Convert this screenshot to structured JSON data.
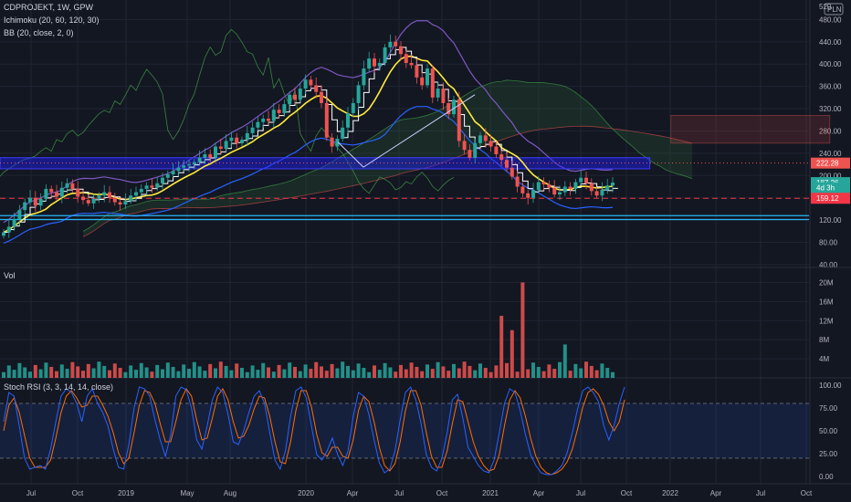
{
  "legend": {
    "symbol": "CDPROJEKT, 1W, GPW",
    "ichimoku": "Ichimoku (20, 60, 120, 30)",
    "bb": "BB (20, close, 2, 0)",
    "vol": "Vol",
    "stoch": "Stoch RSI (3, 3, 14, 14, close)"
  },
  "currency": "PLN",
  "top_label": "520",
  "colors": {
    "bg": "#131722",
    "grid": "#1f2433",
    "up": "#26a69a",
    "down": "#ef5350",
    "tenkan": "#ffffff",
    "kijun": "#ffeb3b",
    "bb": "#2962ff",
    "bb_upper": "#7e57c2",
    "lagging": "#43a047",
    "stoch_k": "#2962ff",
    "stoch_d": "#ff6d00",
    "blue_band": "#1f1fff"
  },
  "chart_data": {
    "type": "candlestick",
    "price_panel": {
      "y_ticks": [
        "480.00",
        "440.00",
        "400.00",
        "360.00",
        "320.00",
        "280.00",
        "240.00",
        "200.00",
        "160.00",
        "120.00",
        "80.00",
        "40.00"
      ],
      "ylim": [
        35,
        515
      ],
      "price_badges": [
        {
          "label": "222.28",
          "value": 222.28,
          "color": "#ef5350"
        },
        {
          "label": "187.26",
          "value": 187.26,
          "color": "#26a69a"
        },
        {
          "label": "4d 3h",
          "value": 178,
          "color": "#26a69a"
        },
        {
          "label": "159.12",
          "value": 159.12,
          "color": "#f23645"
        }
      ],
      "horizontal_levels": [
        {
          "value": 222.28,
          "style": "dotted",
          "color": "#ef5350"
        },
        {
          "value": 159.12,
          "style": "dashed",
          "color": "#f23645"
        },
        {
          "value": 128,
          "style": "solid",
          "color": "#29b6f6"
        },
        {
          "value": 121,
          "style": "solid",
          "color": "#29b6f6"
        }
      ],
      "blue_band_range": [
        212,
        232
      ],
      "close_series": [
        98,
        108,
        122,
        138,
        152,
        160,
        146,
        158,
        176,
        170,
        162,
        178,
        186,
        176,
        162,
        156,
        150,
        158,
        164,
        170,
        160,
        152,
        148,
        154,
        164,
        170,
        176,
        182,
        178,
        186,
        196,
        202,
        208,
        214,
        218,
        220,
        224,
        232,
        238,
        232,
        252,
        248,
        262,
        268,
        258,
        264,
        276,
        286,
        296,
        302,
        298,
        318,
        312,
        328,
        345,
        336,
        356,
        372,
        362,
        350,
        330,
        268,
        252,
        266,
        286,
        312,
        330,
        362,
        392,
        410,
        396,
        402,
        430,
        440,
        432,
        418,
        402,
        398,
        376,
        362,
        392,
        340,
        356,
        330,
        310,
        336,
        262,
        246,
        232,
        258,
        272,
        262,
        252,
        238,
        228,
        214,
        198,
        180,
        168,
        160,
        174,
        188,
        184,
        178,
        166,
        170,
        180,
        176,
        188,
        196,
        186,
        172,
        164,
        174,
        182,
        187.26
      ],
      "x_ticks": [
        "Jul",
        "Oct",
        "2019",
        "May",
        "Aug",
        "2020",
        "Apr",
        "Jul",
        "Oct",
        "2021",
        "Apr",
        "Jul",
        "Oct",
        "2022",
        "Apr",
        "Jul",
        "Oct"
      ]
    },
    "volume_panel": {
      "y_ticks": [
        "20M",
        "16M",
        "12M",
        "8M",
        "4M"
      ],
      "ylim": [
        0,
        22
      ],
      "unit": "M",
      "spikes": [
        {
          "week": 94,
          "value": 13
        },
        {
          "week": 96,
          "value": 10
        },
        {
          "week": 98,
          "value": 20
        },
        {
          "week": 106,
          "value": 7
        }
      ]
    },
    "stoch_panel": {
      "y_ticks": [
        "100.00",
        "75.00",
        "50.00",
        "25.00",
        "0.00"
      ],
      "ylim": [
        -8,
        108
      ],
      "band": [
        20,
        80
      ],
      "k": [
        60,
        92,
        88,
        55,
        20,
        8,
        10,
        12,
        8,
        30,
        60,
        88,
        96,
        92,
        80,
        60,
        88,
        96,
        80,
        70,
        55,
        30,
        10,
        8,
        35,
        75,
        98,
        96,
        88,
        62,
        40,
        22,
        45,
        88,
        98,
        95,
        75,
        40,
        30,
        55,
        84,
        98,
        92,
        68,
        38,
        35,
        50,
        70,
        88,
        94,
        80,
        48,
        18,
        8,
        28,
        66,
        94,
        98,
        86,
        55,
        24,
        18,
        28,
        42,
        24,
        12,
        28,
        66,
        92,
        88,
        68,
        40,
        15,
        4,
        8,
        28,
        62,
        92,
        98,
        84,
        58,
        24,
        10,
        6,
        20,
        48,
        84,
        90,
        64,
        32,
        22,
        12,
        6,
        4,
        18,
        48,
        80,
        96,
        92,
        72,
        46,
        24,
        12,
        4,
        2,
        2,
        6,
        12,
        26,
        48,
        74,
        94,
        98,
        92,
        82,
        56,
        40,
        56,
        80,
        98
      ],
      "d": [
        50,
        78,
        86,
        70,
        45,
        20,
        10,
        10,
        10,
        18,
        42,
        70,
        88,
        94,
        86,
        76,
        78,
        88,
        88,
        78,
        66,
        48,
        26,
        14,
        20,
        48,
        78,
        94,
        92,
        80,
        58,
        38,
        38,
        60,
        84,
        96,
        88,
        62,
        40,
        42,
        64,
        88,
        96,
        84,
        60,
        42,
        44,
        56,
        74,
        88,
        86,
        66,
        38,
        16,
        14,
        38,
        72,
        94,
        94,
        76,
        46,
        26,
        22,
        32,
        32,
        22,
        20,
        40,
        72,
        88,
        82,
        60,
        32,
        12,
        6,
        14,
        38,
        72,
        94,
        94,
        78,
        48,
        22,
        10,
        10,
        28,
        58,
        84,
        82,
        60,
        38,
        22,
        12,
        6,
        8,
        24,
        56,
        84,
        94,
        86,
        66,
        42,
        22,
        10,
        4,
        2,
        4,
        8,
        16,
        30,
        52,
        76,
        92,
        96,
        90,
        78,
        60,
        50,
        60,
        84
      ]
    }
  }
}
